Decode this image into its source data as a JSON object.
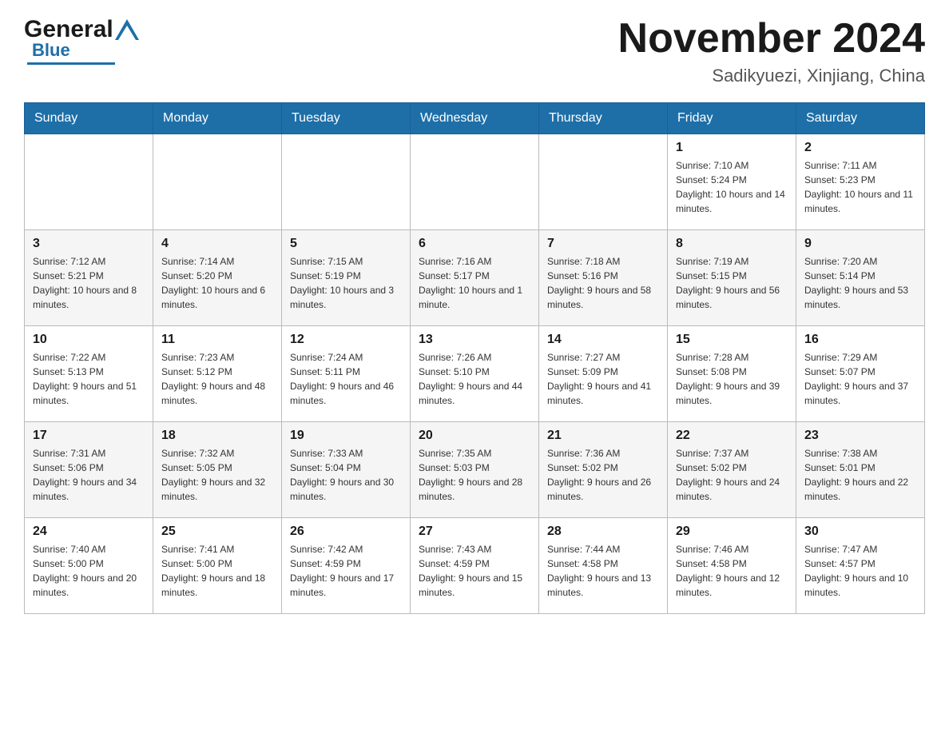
{
  "header": {
    "logo_general": "General",
    "logo_blue": "Blue",
    "title": "November 2024",
    "subtitle": "Sadikyuezi, Xinjiang, China"
  },
  "weekdays": [
    "Sunday",
    "Monday",
    "Tuesday",
    "Wednesday",
    "Thursday",
    "Friday",
    "Saturday"
  ],
  "weeks": [
    [
      {
        "day": "",
        "sunrise": "",
        "sunset": "",
        "daylight": ""
      },
      {
        "day": "",
        "sunrise": "",
        "sunset": "",
        "daylight": ""
      },
      {
        "day": "",
        "sunrise": "",
        "sunset": "",
        "daylight": ""
      },
      {
        "day": "",
        "sunrise": "",
        "sunset": "",
        "daylight": ""
      },
      {
        "day": "",
        "sunrise": "",
        "sunset": "",
        "daylight": ""
      },
      {
        "day": "1",
        "sunrise": "Sunrise: 7:10 AM",
        "sunset": "Sunset: 5:24 PM",
        "daylight": "Daylight: 10 hours and 14 minutes."
      },
      {
        "day": "2",
        "sunrise": "Sunrise: 7:11 AM",
        "sunset": "Sunset: 5:23 PM",
        "daylight": "Daylight: 10 hours and 11 minutes."
      }
    ],
    [
      {
        "day": "3",
        "sunrise": "Sunrise: 7:12 AM",
        "sunset": "Sunset: 5:21 PM",
        "daylight": "Daylight: 10 hours and 8 minutes."
      },
      {
        "day": "4",
        "sunrise": "Sunrise: 7:14 AM",
        "sunset": "Sunset: 5:20 PM",
        "daylight": "Daylight: 10 hours and 6 minutes."
      },
      {
        "day": "5",
        "sunrise": "Sunrise: 7:15 AM",
        "sunset": "Sunset: 5:19 PM",
        "daylight": "Daylight: 10 hours and 3 minutes."
      },
      {
        "day": "6",
        "sunrise": "Sunrise: 7:16 AM",
        "sunset": "Sunset: 5:17 PM",
        "daylight": "Daylight: 10 hours and 1 minute."
      },
      {
        "day": "7",
        "sunrise": "Sunrise: 7:18 AM",
        "sunset": "Sunset: 5:16 PM",
        "daylight": "Daylight: 9 hours and 58 minutes."
      },
      {
        "day": "8",
        "sunrise": "Sunrise: 7:19 AM",
        "sunset": "Sunset: 5:15 PM",
        "daylight": "Daylight: 9 hours and 56 minutes."
      },
      {
        "day": "9",
        "sunrise": "Sunrise: 7:20 AM",
        "sunset": "Sunset: 5:14 PM",
        "daylight": "Daylight: 9 hours and 53 minutes."
      }
    ],
    [
      {
        "day": "10",
        "sunrise": "Sunrise: 7:22 AM",
        "sunset": "Sunset: 5:13 PM",
        "daylight": "Daylight: 9 hours and 51 minutes."
      },
      {
        "day": "11",
        "sunrise": "Sunrise: 7:23 AM",
        "sunset": "Sunset: 5:12 PM",
        "daylight": "Daylight: 9 hours and 48 minutes."
      },
      {
        "day": "12",
        "sunrise": "Sunrise: 7:24 AM",
        "sunset": "Sunset: 5:11 PM",
        "daylight": "Daylight: 9 hours and 46 minutes."
      },
      {
        "day": "13",
        "sunrise": "Sunrise: 7:26 AM",
        "sunset": "Sunset: 5:10 PM",
        "daylight": "Daylight: 9 hours and 44 minutes."
      },
      {
        "day": "14",
        "sunrise": "Sunrise: 7:27 AM",
        "sunset": "Sunset: 5:09 PM",
        "daylight": "Daylight: 9 hours and 41 minutes."
      },
      {
        "day": "15",
        "sunrise": "Sunrise: 7:28 AM",
        "sunset": "Sunset: 5:08 PM",
        "daylight": "Daylight: 9 hours and 39 minutes."
      },
      {
        "day": "16",
        "sunrise": "Sunrise: 7:29 AM",
        "sunset": "Sunset: 5:07 PM",
        "daylight": "Daylight: 9 hours and 37 minutes."
      }
    ],
    [
      {
        "day": "17",
        "sunrise": "Sunrise: 7:31 AM",
        "sunset": "Sunset: 5:06 PM",
        "daylight": "Daylight: 9 hours and 34 minutes."
      },
      {
        "day": "18",
        "sunrise": "Sunrise: 7:32 AM",
        "sunset": "Sunset: 5:05 PM",
        "daylight": "Daylight: 9 hours and 32 minutes."
      },
      {
        "day": "19",
        "sunrise": "Sunrise: 7:33 AM",
        "sunset": "Sunset: 5:04 PM",
        "daylight": "Daylight: 9 hours and 30 minutes."
      },
      {
        "day": "20",
        "sunrise": "Sunrise: 7:35 AM",
        "sunset": "Sunset: 5:03 PM",
        "daylight": "Daylight: 9 hours and 28 minutes."
      },
      {
        "day": "21",
        "sunrise": "Sunrise: 7:36 AM",
        "sunset": "Sunset: 5:02 PM",
        "daylight": "Daylight: 9 hours and 26 minutes."
      },
      {
        "day": "22",
        "sunrise": "Sunrise: 7:37 AM",
        "sunset": "Sunset: 5:02 PM",
        "daylight": "Daylight: 9 hours and 24 minutes."
      },
      {
        "day": "23",
        "sunrise": "Sunrise: 7:38 AM",
        "sunset": "Sunset: 5:01 PM",
        "daylight": "Daylight: 9 hours and 22 minutes."
      }
    ],
    [
      {
        "day": "24",
        "sunrise": "Sunrise: 7:40 AM",
        "sunset": "Sunset: 5:00 PM",
        "daylight": "Daylight: 9 hours and 20 minutes."
      },
      {
        "day": "25",
        "sunrise": "Sunrise: 7:41 AM",
        "sunset": "Sunset: 5:00 PM",
        "daylight": "Daylight: 9 hours and 18 minutes."
      },
      {
        "day": "26",
        "sunrise": "Sunrise: 7:42 AM",
        "sunset": "Sunset: 4:59 PM",
        "daylight": "Daylight: 9 hours and 17 minutes."
      },
      {
        "day": "27",
        "sunrise": "Sunrise: 7:43 AM",
        "sunset": "Sunset: 4:59 PM",
        "daylight": "Daylight: 9 hours and 15 minutes."
      },
      {
        "day": "28",
        "sunrise": "Sunrise: 7:44 AM",
        "sunset": "Sunset: 4:58 PM",
        "daylight": "Daylight: 9 hours and 13 minutes."
      },
      {
        "day": "29",
        "sunrise": "Sunrise: 7:46 AM",
        "sunset": "Sunset: 4:58 PM",
        "daylight": "Daylight: 9 hours and 12 minutes."
      },
      {
        "day": "30",
        "sunrise": "Sunrise: 7:47 AM",
        "sunset": "Sunset: 4:57 PM",
        "daylight": "Daylight: 9 hours and 10 minutes."
      }
    ]
  ]
}
